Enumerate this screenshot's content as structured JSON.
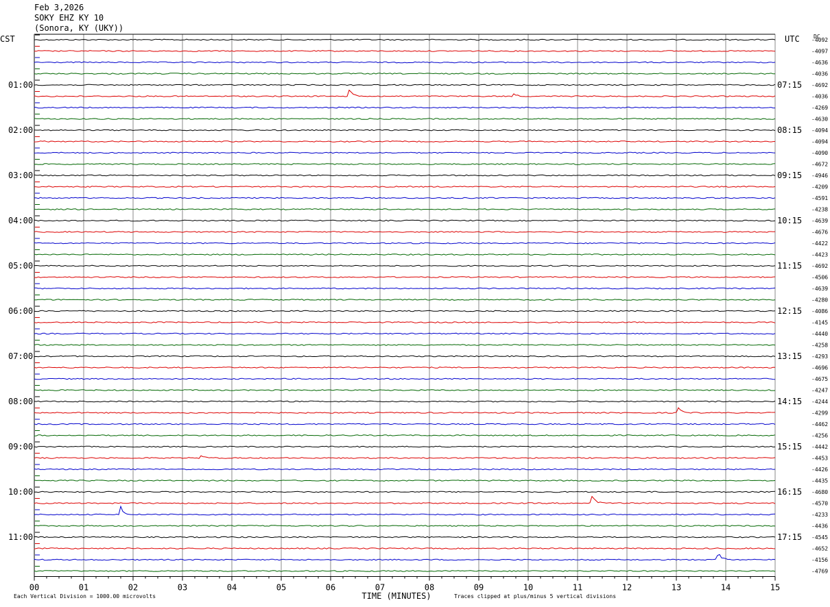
{
  "header": {
    "date": "Feb 3,2026",
    "station": "SOKY EHZ KY 10",
    "location": "(Sonora, KY (UKY))"
  },
  "left_timezone": "CST",
  "right_timezone": "UTC",
  "dc_label": "DC",
  "footer": {
    "scale_note": "Each Vertical Division = 1000.00 microvolts",
    "clip_note": "Traces clipped at plus/minus 5 vertical divisions"
  },
  "colors": {
    "trace_cycle": [
      "#000000",
      "#dd0000",
      "#0000cc",
      "#006600"
    ],
    "grid": "#888888"
  },
  "chart_data": {
    "type": "line",
    "title": "",
    "xlabel": "TIME (MINUTES)",
    "xlim": [
      0,
      15
    ],
    "x_ticks": [
      "00",
      "01",
      "02",
      "03",
      "04",
      "05",
      "06",
      "07",
      "08",
      "09",
      "10",
      "11",
      "12",
      "13",
      "14",
      "15"
    ],
    "rows_per_hour": 4,
    "row_count": 48,
    "left_hour_labels": [
      "01:00",
      "02:00",
      "03:00",
      "04:00",
      "05:00",
      "06:00",
      "07:00",
      "08:00",
      "09:00",
      "10:00",
      "11:00"
    ],
    "right_hour_labels": [
      "07:15",
      "08:15",
      "09:15",
      "10:15",
      "11:15",
      "12:15",
      "13:15",
      "14:15",
      "15:15",
      "16:15",
      "17:15"
    ],
    "dc_offsets": [
      "-4092",
      "-4097",
      "-4636",
      "-4036",
      "-4692",
      "-4036",
      "-4269",
      "-4630",
      "-4094",
      "-4094",
      "-4090",
      "-4672",
      "-4946",
      "-4209",
      "-4591",
      "-4238",
      "-4639",
      "-4676",
      "-4422",
      "-4423",
      "-4692",
      "-4506",
      "-4639",
      "-4280",
      "-4086",
      "-4145",
      "-4440",
      "-4258",
      "-4293",
      "-4696",
      "-4675",
      "-4247",
      "-4244",
      "-4299",
      "-4462",
      "-4256",
      "-4442",
      "-4453",
      "-4426",
      "-4435",
      "-4680",
      "-4570",
      "-4233",
      "-4436",
      "-4545",
      "-4652",
      "-4156",
      "-4769"
    ],
    "events": [
      {
        "row": 5,
        "minute": 6.4,
        "amplitude": 0.5
      },
      {
        "row": 5,
        "minute": 9.7,
        "amplitude": 0.2
      },
      {
        "row": 33,
        "minute": 13.05,
        "amplitude": 0.4
      },
      {
        "row": 37,
        "minute": 3.4,
        "amplitude": 0.3
      },
      {
        "row": 41,
        "minute": 11.3,
        "amplitude": 0.6
      },
      {
        "row": 42,
        "minute": 1.75,
        "amplitude": 0.7
      },
      {
        "row": 46,
        "minute": 13.85,
        "amplitude": 0.6
      }
    ]
  }
}
